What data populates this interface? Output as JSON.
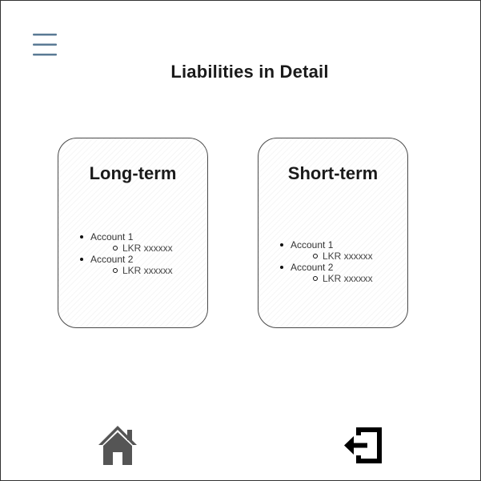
{
  "page": {
    "title": "Liabilities in Detail"
  },
  "cards": [
    {
      "title": "Long-term",
      "accounts": [
        {
          "name": "Account 1",
          "amount": "LKR xxxxxx"
        },
        {
          "name": "Account 2",
          "amount": "LKR xxxxxx"
        }
      ]
    },
    {
      "title": "Short-term",
      "accounts": [
        {
          "name": "Account 1",
          "amount": "LKR xxxxxx"
        },
        {
          "name": "Account 2",
          "amount": "LKR xxxxxx"
        }
      ]
    }
  ],
  "icons": {
    "menu": "hamburger-menu-icon",
    "home": "home-icon",
    "logout": "logout-icon"
  },
  "colors": {
    "menu_icon": "#5a7a94",
    "nav_icons": "#555555",
    "logout_icon": "#000000"
  }
}
